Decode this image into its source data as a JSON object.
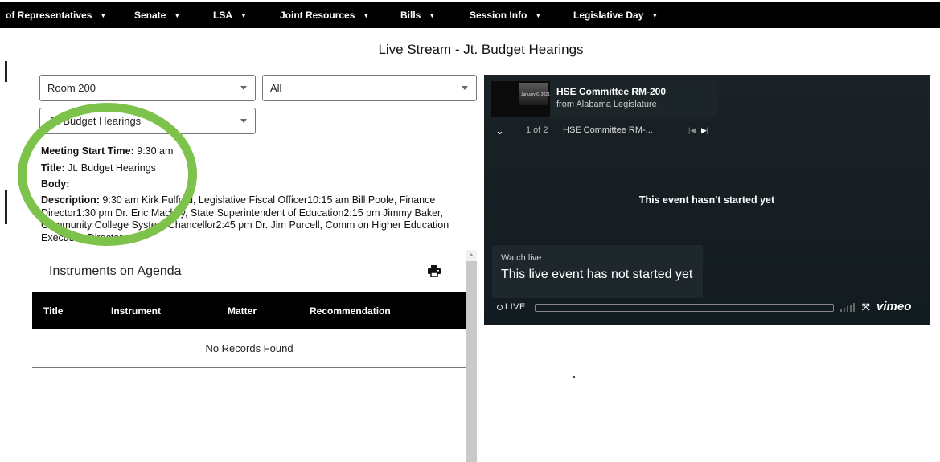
{
  "nav": {
    "items": [
      {
        "label": "of Representatives"
      },
      {
        "label": "Senate"
      },
      {
        "label": "LSA"
      },
      {
        "label": "Joint Resources"
      },
      {
        "label": "Bills"
      },
      {
        "label": "Session Info"
      },
      {
        "label": "Legislative Day"
      }
    ]
  },
  "page": {
    "title": "Live Stream - Jt. Budget Hearings"
  },
  "filters": {
    "room": "Room 200",
    "category": "All",
    "meeting": "Jt. Budget Hearings"
  },
  "meeting": {
    "start_label": "Meeting Start Time:",
    "start_value": "9:30 am",
    "title_label": "Title:",
    "title_value": "Jt. Budget Hearings",
    "body_label": "Body:",
    "body_value": "",
    "description_label": "Description:",
    "description_value": "9:30 am Kirk Fulford, Legislative Fiscal Officer10:15 am Bill Poole, Finance Director1:30 pm Dr. Eric Mackey, State Superintendent of Education2:15 pm Jimmy Baker, Community College System Chancellor2:45 pm Dr. Jim Purcell, Comm on Higher Education Executive Director"
  },
  "instruments": {
    "title": "Instruments on Agenda",
    "columns": [
      "Title",
      "Instrument",
      "Matter",
      "Recommendation"
    ],
    "empty_text": "No Records Found"
  },
  "player": {
    "title": "HSE Committee RM-200",
    "subtitle": "from Alabama Legislature",
    "count": "1 of 2",
    "current_item": "HSE Committee RM-...",
    "status_message": "This event hasn't started yet",
    "watch_label": "Watch live",
    "watch_text": "This live event has not started yet",
    "live_label": "LIVE",
    "brand": "vimeo",
    "thumb_caption": "January 6, 2021"
  },
  "colors": {
    "nav_bg": "#000000",
    "annotation_ring": "#7dc24a",
    "player_bg": "#141c20",
    "table_header_bg": "#000000"
  }
}
